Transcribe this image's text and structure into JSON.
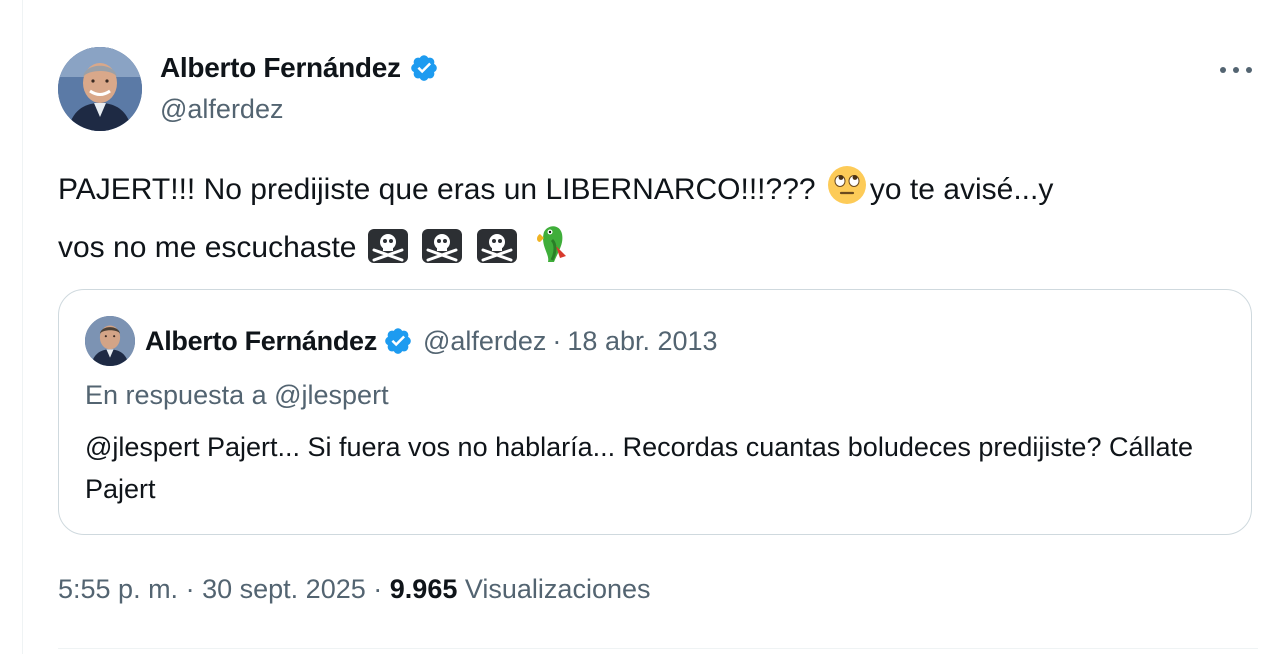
{
  "author": {
    "name": "Alberto Fernández",
    "handle": "@alferdez",
    "verified": true,
    "avatar_icon": "profile-photo-smiling-man"
  },
  "tweet": {
    "text_part1": "PAJERT!!! No predijiste que eras un LIBERNARCO!!!???",
    "emoji_eyeroll": "face-with-rolling-eyes-icon",
    "text_part2": "yo te avisé...y",
    "text_line2": "vos no me escuchaste",
    "emoji_trailing": [
      "skull-and-crossbones-icon",
      "skull-and-crossbones-icon",
      "skull-and-crossbones-icon",
      "parrot-icon"
    ]
  },
  "quoted_tweet": {
    "author_name": "Alberto Fernández",
    "author_handle": "@alferdez",
    "separator": "·",
    "date": "18 abr. 2013",
    "reply_to": "En respuesta a @jlespert",
    "text": "@jlespert Pajert... Si fuera vos no hablaría... Recordas cuantas boludeces predijiste? Cállate Pajert"
  },
  "meta": {
    "time": "5:55 p. m.",
    "separator": "·",
    "date": "30 sept. 2025",
    "views_count": "9.965",
    "views_label": "Visualizaciones"
  },
  "colors": {
    "verified_blue": "#1d9bf0",
    "secondary_text": "#536471",
    "primary_text": "#0f1419",
    "border": "#cfd9de"
  }
}
